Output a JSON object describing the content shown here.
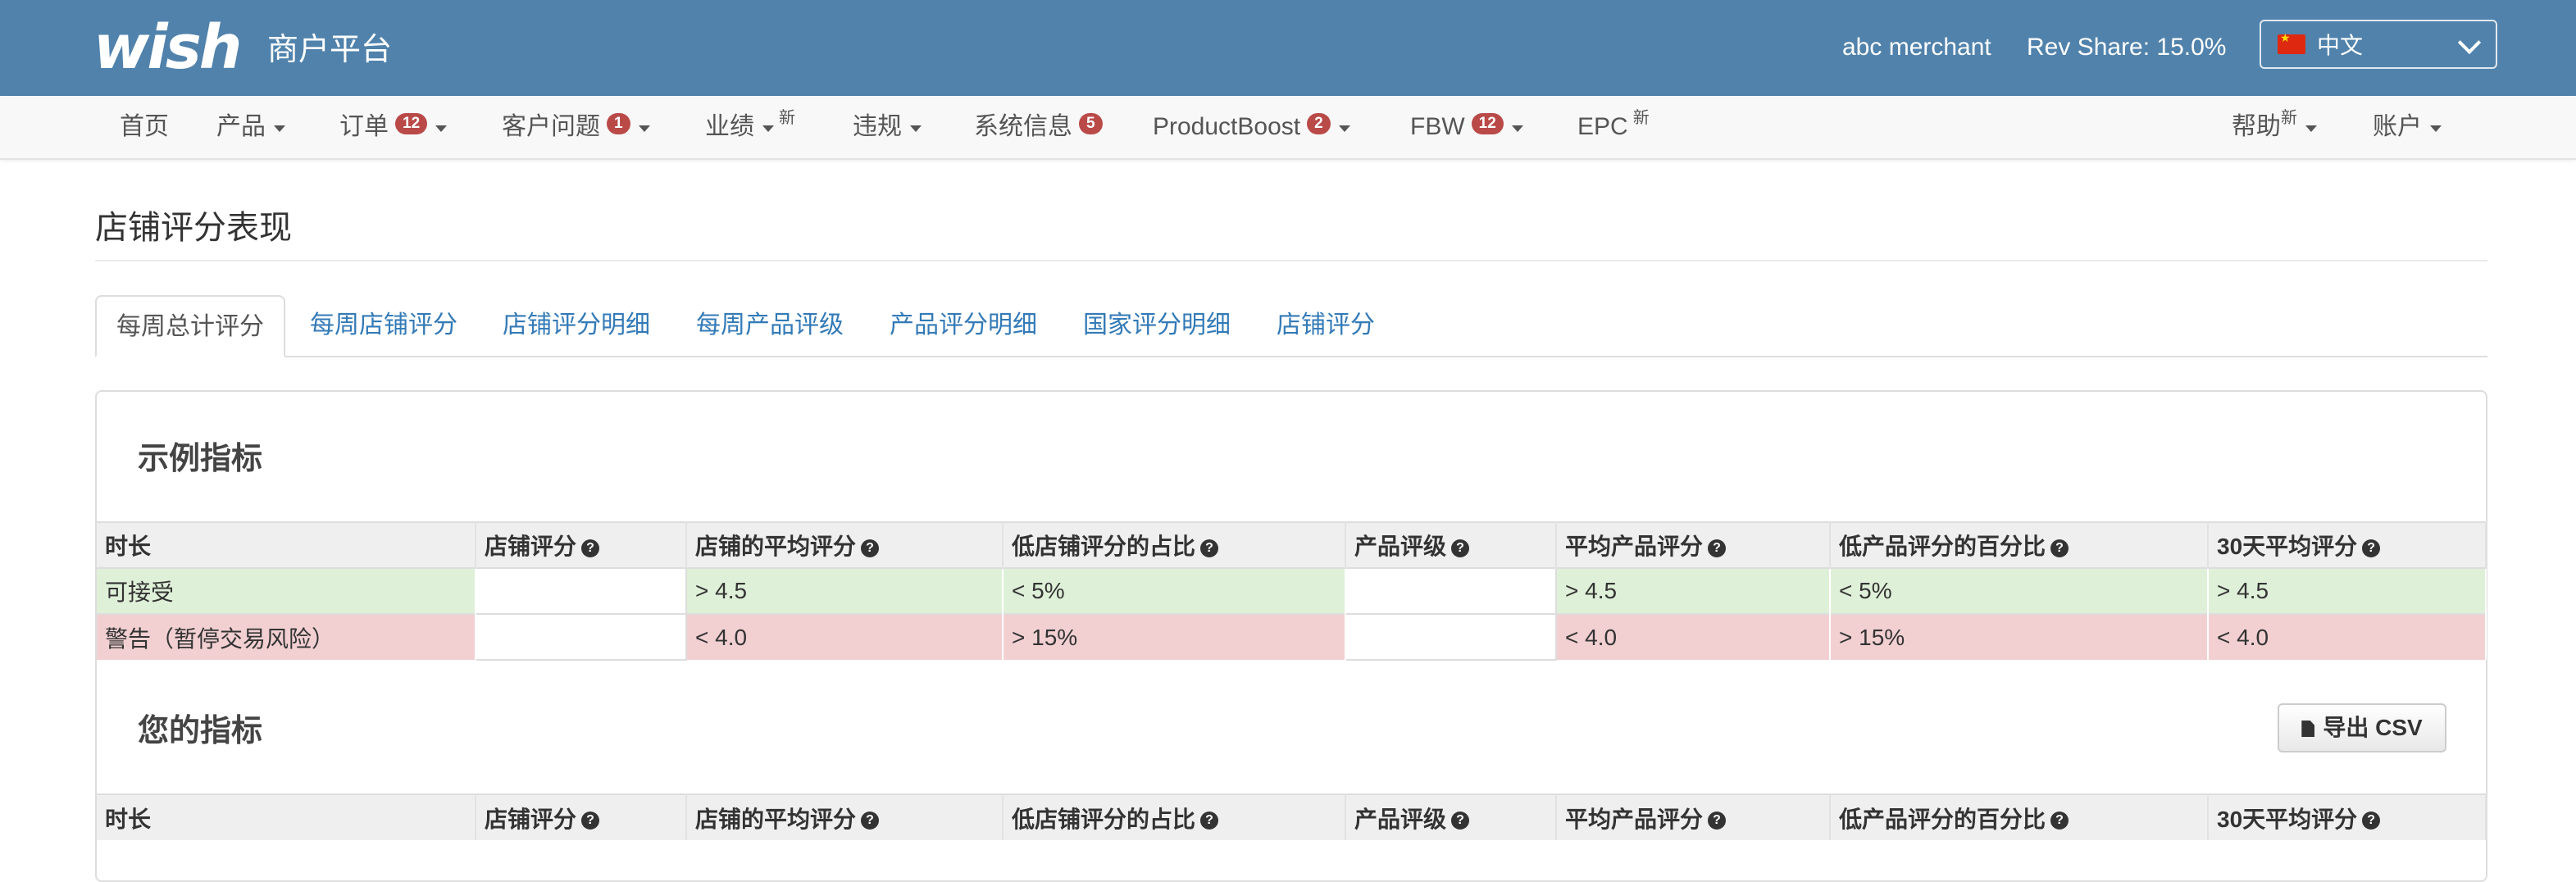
{
  "header": {
    "logo": "wish",
    "platform": "商户平台",
    "merchant": "abc merchant",
    "rev_share": "Rev Share: 15.0%",
    "language": "中文"
  },
  "nav": {
    "items": [
      {
        "label": "首页"
      },
      {
        "label": "产品"
      },
      {
        "label": "订单",
        "badge": "12"
      },
      {
        "label": "客户问题",
        "badge": "1"
      },
      {
        "label": "业绩",
        "tag": "新"
      },
      {
        "label": "违规"
      },
      {
        "label": "系统信息",
        "badge": "5"
      },
      {
        "label": "ProductBoost",
        "badge": "2"
      },
      {
        "label": "FBW",
        "badge": "12"
      },
      {
        "label": "EPC",
        "tag": "新"
      },
      {
        "label": "帮助",
        "tag": "新"
      },
      {
        "label": "账户"
      }
    ]
  },
  "page": {
    "title": "店铺评分表现",
    "tabs": [
      "每周总计评分",
      "每周店铺评分",
      "店铺评分明细",
      "每周产品评级",
      "产品评分明细",
      "国家评分明细",
      "店铺评分"
    ]
  },
  "example": {
    "title": "示例指标",
    "headers": [
      "时长",
      "店铺评分",
      "店铺的平均评分",
      "低店铺评分的占比",
      "产品评级",
      "平均产品评分",
      "低产品评分的百分比",
      "30天平均评分"
    ],
    "rows": [
      [
        "可接受",
        "",
        "> 4.5",
        "< 5%",
        "",
        "> 4.5",
        "< 5%",
        "> 4.5"
      ],
      [
        "警告（暂停交易风险）",
        "",
        "< 4.0",
        "> 15%",
        "",
        "< 4.0",
        "> 15%",
        "< 4.0"
      ]
    ]
  },
  "yours": {
    "title": "您的指标",
    "export_label": "导出 CSV",
    "headers": [
      "时长",
      "店铺评分",
      "店铺的平均评分",
      "低店铺评分的占比",
      "产品评级",
      "平均产品评分",
      "低产品评分的百分比",
      "30天平均评分"
    ]
  },
  "colors": {
    "header_bg": "#5082AB",
    "badge": "#B94A48",
    "link": "#337AB7",
    "ok_row": "#DFF0D8",
    "warn_row": "#F2D0D2"
  }
}
